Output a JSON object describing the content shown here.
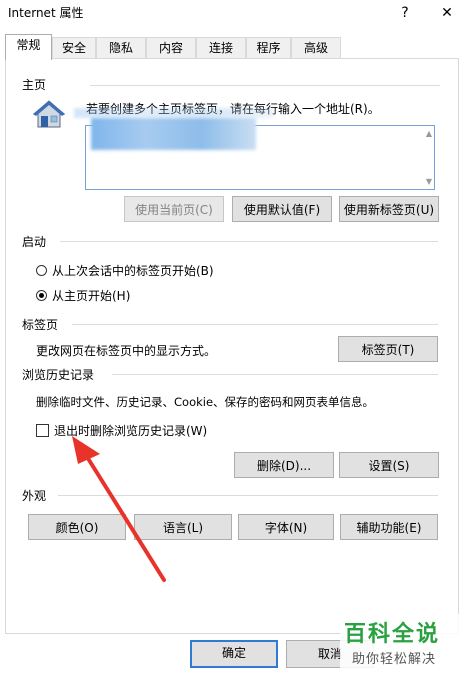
{
  "window": {
    "title": "Internet 属性",
    "help_glyph": "?",
    "close_glyph": "✕"
  },
  "tabs": [
    {
      "label": "常规",
      "active": true
    },
    {
      "label": "安全"
    },
    {
      "label": "隐私"
    },
    {
      "label": "内容"
    },
    {
      "label": "连接"
    },
    {
      "label": "程序"
    },
    {
      "label": "高级"
    }
  ],
  "home": {
    "section_title": "主页",
    "instruction": "若要创建多个主页标签页，请在每行输入一个地址(R)。",
    "use_current_label": "使用当前页(C)",
    "use_default_label": "使用默认值(F)",
    "use_new_tab_label": "使用新标签页(U)"
  },
  "startup": {
    "section_title": "启动",
    "option_last_session": "从上次会话中的标签页开始(B)",
    "option_home": "从主页开始(H)",
    "selected": "home"
  },
  "tabs_section": {
    "section_title": "标签页",
    "description": "更改网页在标签页中的显示方式。",
    "button_label": "标签页(T)"
  },
  "history": {
    "section_title": "浏览历史记录",
    "description": "删除临时文件、历史记录、Cookie、保存的密码和网页表单信息。",
    "delete_on_exit_label": "退出时删除浏览历史记录(W)",
    "delete_on_exit_checked": false,
    "delete_label": "删除(D)...",
    "settings_label": "设置(S)"
  },
  "appearance": {
    "section_title": "外观",
    "colors_label": "颜色(O)",
    "languages_label": "语言(L)",
    "fonts_label": "字体(N)",
    "accessibility_label": "辅助功能(E)"
  },
  "footer": {
    "ok_label": "确定",
    "cancel_label": "取消"
  },
  "watermark": {
    "title": "百科全说",
    "subtitle": "助你轻松解决"
  },
  "colors": {
    "annotation_arrow": "#e8332a",
    "focus_border": "#2f7ad2",
    "watermark_green": "#2aa140"
  }
}
